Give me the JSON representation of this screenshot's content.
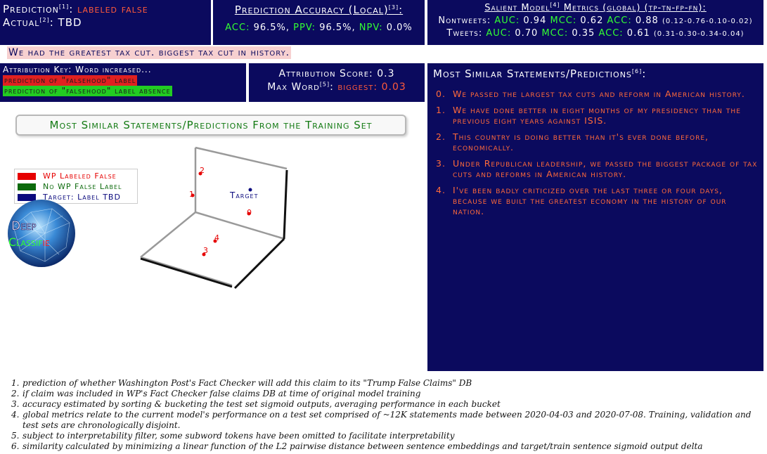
{
  "prediction": {
    "label": "Prediction",
    "sup": "[1]",
    "value": "labeled false",
    "actual_label": "Actual",
    "actual_sup": "[2]",
    "actual_value": "TBD"
  },
  "accuracy": {
    "title": "Prediction Accuracy (Local)",
    "sup": "[3]",
    "acc_label": "ACC:",
    "acc_value": "96.5%,",
    "ppv_label": "PPV:",
    "ppv_value": "96.5%,",
    "npv_label": "NPV:",
    "npv_value": "0.0%"
  },
  "metrics": {
    "title_a": "Salient Model",
    "sup": "[4]",
    "title_b": "Metrics (global) (tp-tn-fp-fn):",
    "nontweets": {
      "label": "Nontweets:",
      "auc_label": "AUC:",
      "auc": "0.94",
      "mcc_label": "MCC:",
      "mcc": "0.62",
      "acc_label": "ACC:",
      "acc": "0.88",
      "counts": "(0.12-0.76-0.10-0.02)"
    },
    "tweets": {
      "label": "Tweets:",
      "auc_label": "AUC:",
      "auc": "0.70",
      "mcc_label": "MCC:",
      "mcc": "0.35",
      "acc_label": "ACC:",
      "acc": "0.61",
      "counts": "(0.31-0.30-0.34-0.04)"
    }
  },
  "statement": "We had the greatest tax cut. biggest tax cut in history.",
  "attribution_key": {
    "title": "Attribution Key: Word increased...",
    "increase": "prediction of \"falsehood\" label",
    "absence": "prediction of \"falsehood\" label absence"
  },
  "attribution": {
    "score_label": "Attribution Score:",
    "score_value": "0.3",
    "max_label": "Max Word",
    "max_sup": "[5]",
    "max_word": "biggest:",
    "max_value": "0.03"
  },
  "similar": {
    "title": "Most Similar Statements/Predictions",
    "sup": "[6]",
    "items": [
      {
        "n": "0.",
        "text": "We passed the largest tax cuts and reform in American history."
      },
      {
        "n": "1.",
        "text": "We have done better in eight months of my presidency than the previous eight years against ISIS."
      },
      {
        "n": "2.",
        "text": "This country is doing better than it's ever done before, economically."
      },
      {
        "n": "3.",
        "text": "Under Republican leadership, we passed the biggest package of tax cuts and reforms in American history."
      },
      {
        "n": "4.",
        "text": "I've been badly criticized over the last three or four days, because we built the greatest economy in the history of our nation."
      }
    ]
  },
  "training_title": "Most Similar Statements/Predictions From the Training Set",
  "legend": {
    "items": [
      {
        "label": "WP Labeled False",
        "color": "#e60000",
        "text_color": "#e60000"
      },
      {
        "label": "No WP False Label",
        "color": "#0c6a0c",
        "text_color": "#0c6a0c"
      },
      {
        "label": "Target: Label TBD",
        "color": "#0b0a7e",
        "text_color": "#0b0a7e"
      }
    ]
  },
  "logo": {
    "line1": "Deep",
    "line2a": "Classif",
    "line2b": "ie"
  },
  "plot": {
    "target_label": "Target",
    "points": [
      "0",
      "1",
      "2",
      "3",
      "4"
    ]
  },
  "footnotes": [
    {
      "n": "1.",
      "text": "prediction of whether Washington Post's Fact Checker will add this claim to its \"Trump False Claims\" DB"
    },
    {
      "n": "2.",
      "text": "if claim was included in WP's Fact Checker false claims DB at time of original model training"
    },
    {
      "n": "3.",
      "text": "accuracy estimated by sorting & bucketing the test set sigmoid outputs, averaging performance in each bucket"
    },
    {
      "n": "4.",
      "text": "global metrics relate to the current model's performance on a test set comprised of ~12K statements made between 2020-04-03 and 2020-07-08. Training, validation and test sets are chronologically disjoint."
    },
    {
      "n": "5.",
      "text": "subject to interpretability filter, some subword tokens have been omitted to facilitate interpretability"
    },
    {
      "n": "6.",
      "text": "similarity calculated by minimizing a linear function of the L2 pairwise distance between sentence embeddings and target/train sentence sigmoid output delta"
    }
  ],
  "colors": {
    "panel": "#0b0a5e",
    "accent_red": "#ff5a3a",
    "accent_green": "#33ff33",
    "list_text": "#ff6a3a"
  }
}
